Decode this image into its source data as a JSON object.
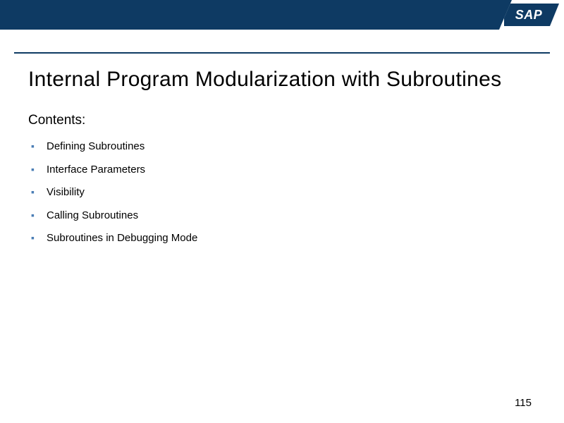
{
  "logo": {
    "text": "SAP"
  },
  "slide": {
    "title": "Internal Program Modularization with Subroutines",
    "contents_label": "Contents:",
    "bullets": [
      "Defining Subroutines",
      "Interface Parameters",
      "Visibility",
      "Calling Subroutines",
      "Subroutines in Debugging Mode"
    ],
    "page_number": "115"
  }
}
